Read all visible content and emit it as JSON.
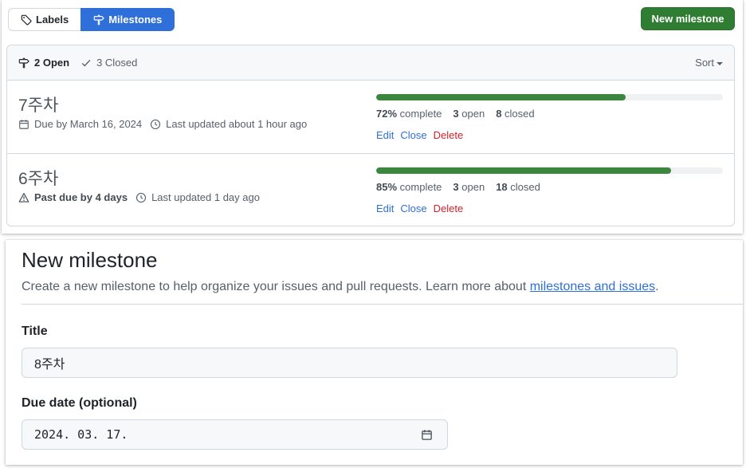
{
  "tabs": {
    "labels": "Labels",
    "milestones": "Milestones"
  },
  "new_milestone_button": "New milestone",
  "filter": {
    "open": "2 Open",
    "closed": "3 Closed",
    "sort": "Sort"
  },
  "milestones": [
    {
      "title": "7주차",
      "due": "Due by March 16, 2024",
      "updated": "Last updated about 1 hour ago",
      "progress_fraction": 0.72,
      "percent": "72%",
      "complete_label": "complete",
      "open_count": "3",
      "open_label": "open",
      "closed_count": "8",
      "closed_label": "closed",
      "actions": [
        "Edit",
        "Close",
        "Delete"
      ]
    },
    {
      "title": "6주차",
      "due": "Past due by 4 days",
      "updated": "Last updated 1 day ago",
      "progress_fraction": 0.85,
      "percent": "85%",
      "complete_label": "complete",
      "open_count": "3",
      "open_label": "open",
      "closed_count": "18",
      "closed_label": "closed",
      "actions": [
        "Edit",
        "Close",
        "Delete"
      ]
    }
  ],
  "form": {
    "heading": "New milestone",
    "description": "Create a new milestone to help organize your issues and pull requests. Learn more about ",
    "link_text": "milestones and issues",
    "description_end": ".",
    "title_label": "Title",
    "title_value": "8주차",
    "due_label": "Due date (optional)",
    "due_value": "2024. 03. 17."
  },
  "colors": {
    "accent_blue": "#2f6fd9",
    "primary_green": "#2e7d32",
    "progress_green": "#3b873f",
    "danger_red": "#cf222e"
  },
  "icons": [
    "tag-icon",
    "milestone-icon",
    "check-icon",
    "calendar-icon",
    "clock-icon",
    "alert-icon"
  ]
}
